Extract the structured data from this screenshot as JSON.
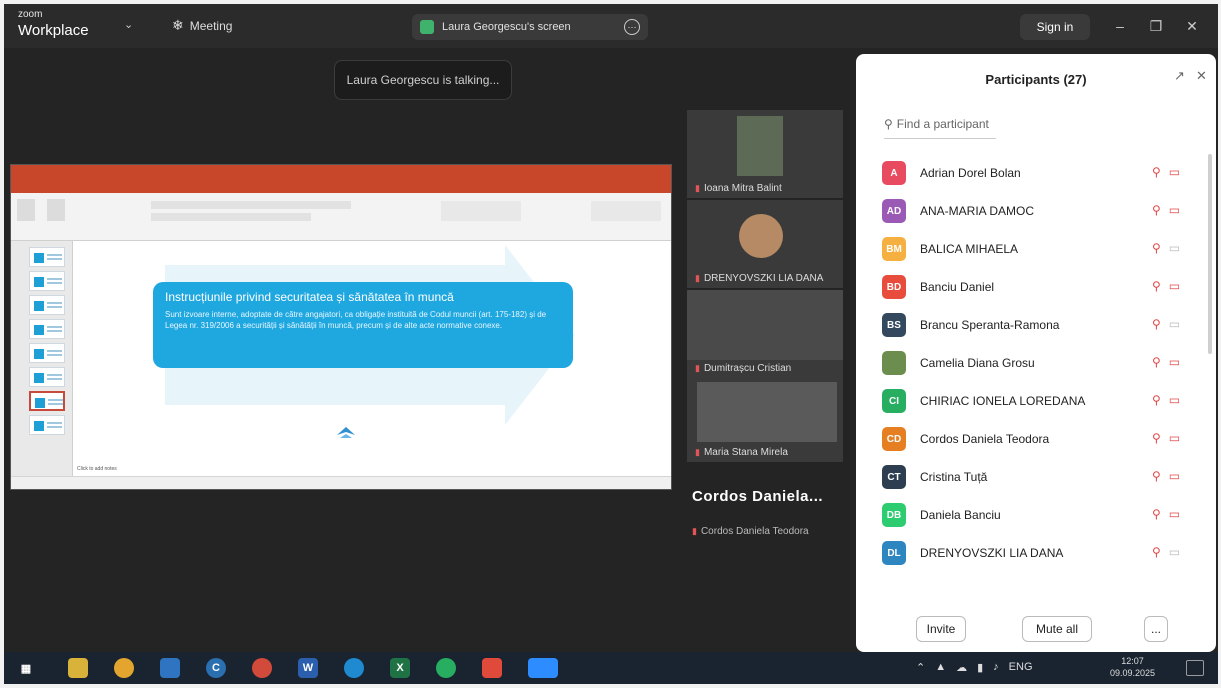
{
  "topbar": {
    "brand_small": "zoom",
    "brand_big": "Workplace",
    "meeting_label": "Meeting",
    "screen_label": "Laura Georgescu's screen",
    "sign_in": "Sign in"
  },
  "notification": {
    "talking": "Laura Georgescu is talking..."
  },
  "shared_slide": {
    "heading": "Instrucțiunile privind securitatea și sănătatea în muncă",
    "body": "Sunt izvoare interne, adoptate de către angajatori, ca obligație instituită de Codul muncii (art. 175-182) și de Legea nr. 319/2006 a securității și sănătății în muncă, precum și de alte acte normative conexe.",
    "notes_placeholder": "Click to add notes"
  },
  "video_tiles": [
    {
      "name": "Ioana Mitra Balint"
    },
    {
      "name": "DRENYOVSZKI LIA DANA"
    },
    {
      "name": "Dumitrașcu Cristian"
    },
    {
      "name": "Maria Stana Mirela"
    }
  ],
  "active_speaker": {
    "name": "Cordos Daniela...",
    "sub": "Cordos Daniela Teodora"
  },
  "participants_panel": {
    "title": "Participants (27)",
    "search_placeholder": "Find a participant",
    "participants": [
      {
        "initials": "A",
        "name": "Adrian Dorel Bolan",
        "color": "#e84a5f",
        "video": "off"
      },
      {
        "initials": "AD",
        "name": "ANA-MARIA DAMOC",
        "color": "#9b59b6",
        "video": "off"
      },
      {
        "initials": "BM",
        "name": "BALICA MIHAELA",
        "color": "#f5b041",
        "video": "on"
      },
      {
        "initials": "BD",
        "name": "Banciu Daniel",
        "color": "#e74c3c",
        "video": "off"
      },
      {
        "initials": "BS",
        "name": "Brancu Speranta-Ramona",
        "color": "#34495e",
        "video": "on"
      },
      {
        "initials": "",
        "name": "Camelia Diana Grosu",
        "color": "#6b8e4e",
        "video": "off"
      },
      {
        "initials": "CI",
        "name": "CHIRIAC IONELA LOREDANA",
        "color": "#27ae60",
        "video": "off"
      },
      {
        "initials": "CD",
        "name": "Cordos Daniela Teodora",
        "color": "#e67e22",
        "video": "off"
      },
      {
        "initials": "CT",
        "name": "Cristina Tuță",
        "color": "#2c3e50",
        "video": "off"
      },
      {
        "initials": "DB",
        "name": "Daniela Banciu",
        "color": "#2ecc71",
        "video": "off"
      },
      {
        "initials": "DL",
        "name": "DRENYOVSZKI LIA DANA",
        "color": "#2e86c1",
        "video": "on"
      }
    ],
    "invite": "Invite",
    "mute_all": "Mute all",
    "more": "..."
  },
  "taskbar": {
    "lang": "ENG",
    "time": "12:07",
    "date": "09.09.2025"
  }
}
